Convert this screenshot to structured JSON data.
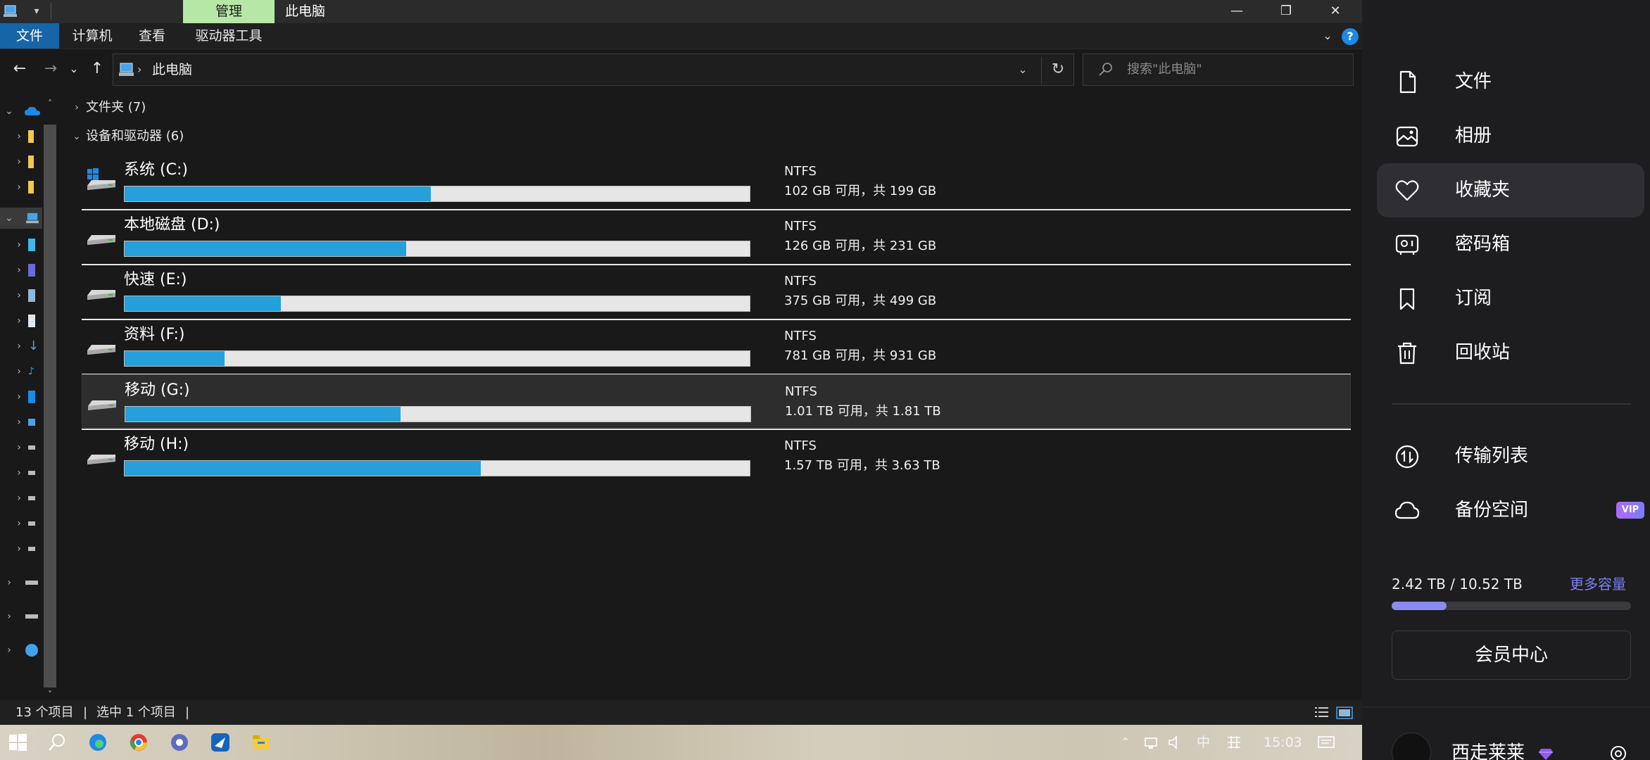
{
  "titlebar": {
    "manage_tab": "管理",
    "window_title": "此电脑",
    "quick_access": "▾",
    "minimize": "—",
    "maximize": "❐",
    "close": "✕"
  },
  "ribbon": {
    "tabs": [
      "文件",
      "计算机",
      "查看",
      "驱动器工具"
    ],
    "help": "?"
  },
  "navbar": {
    "back": "←",
    "forward": "→",
    "recent": "⌄",
    "up": "↑",
    "breadcrumb": "此电脑",
    "refresh": "↻",
    "search_placeholder": "搜索\"此电脑\""
  },
  "content": {
    "groups": [
      {
        "label": "文件夹 (7)",
        "expanded": false
      },
      {
        "label": "设备和驱动器 (6)",
        "expanded": true
      }
    ],
    "drives": [
      {
        "name": "系统 (C:)",
        "fs": "NTFS",
        "space": "102 GB 可用，共 199 GB",
        "used_fraction": 0.49,
        "system": true,
        "selected": false
      },
      {
        "name": "本地磁盘 (D:)",
        "fs": "NTFS",
        "space": "126 GB 可用，共 231 GB",
        "used_fraction": 0.45,
        "system": false,
        "selected": false
      },
      {
        "name": "快速 (E:)",
        "fs": "NTFS",
        "space": "375 GB 可用，共 499 GB",
        "used_fraction": 0.25,
        "system": false,
        "selected": false
      },
      {
        "name": "资料 (F:)",
        "fs": "NTFS",
        "space": "781 GB 可用，共 931 GB",
        "used_fraction": 0.16,
        "system": false,
        "selected": false
      },
      {
        "name": "移动 (G:)",
        "fs": "NTFS",
        "space": "1.01 TB 可用，共 1.81 TB",
        "used_fraction": 0.44,
        "system": false,
        "selected": true
      },
      {
        "name": "移动 (H:)",
        "fs": "NTFS",
        "space": "1.57 TB 可用，共 3.63 TB",
        "used_fraction": 0.57,
        "system": false,
        "selected": false
      }
    ]
  },
  "statusbar": {
    "item_count": "13 个项目",
    "selected_count": "选中 1 个项目",
    "separator": "|"
  },
  "taskbar": {
    "tray_ime": "中",
    "tray_time": "15:03"
  },
  "panel": {
    "menu": [
      {
        "label": "文件",
        "icon": "file-icon"
      },
      {
        "label": "相册",
        "icon": "album-icon"
      },
      {
        "label": "收藏夹",
        "icon": "heart-icon",
        "active": true
      },
      {
        "label": "密码箱",
        "icon": "safe-icon"
      },
      {
        "label": "订阅",
        "icon": "bookmark-icon"
      },
      {
        "label": "回收站",
        "icon": "trash-icon"
      }
    ],
    "menu2": [
      {
        "label": "传输列表",
        "icon": "transfer-icon"
      },
      {
        "label": "备份空间",
        "icon": "cloud-icon",
        "badge": "VIP"
      }
    ],
    "storage_text": "2.42 TB / 10.52 TB",
    "storage_fraction": 0.23,
    "more_storage": "更多容量",
    "vip_center": "会员中心",
    "username": "西走莱莱",
    "accent": "#7b7ff5"
  }
}
